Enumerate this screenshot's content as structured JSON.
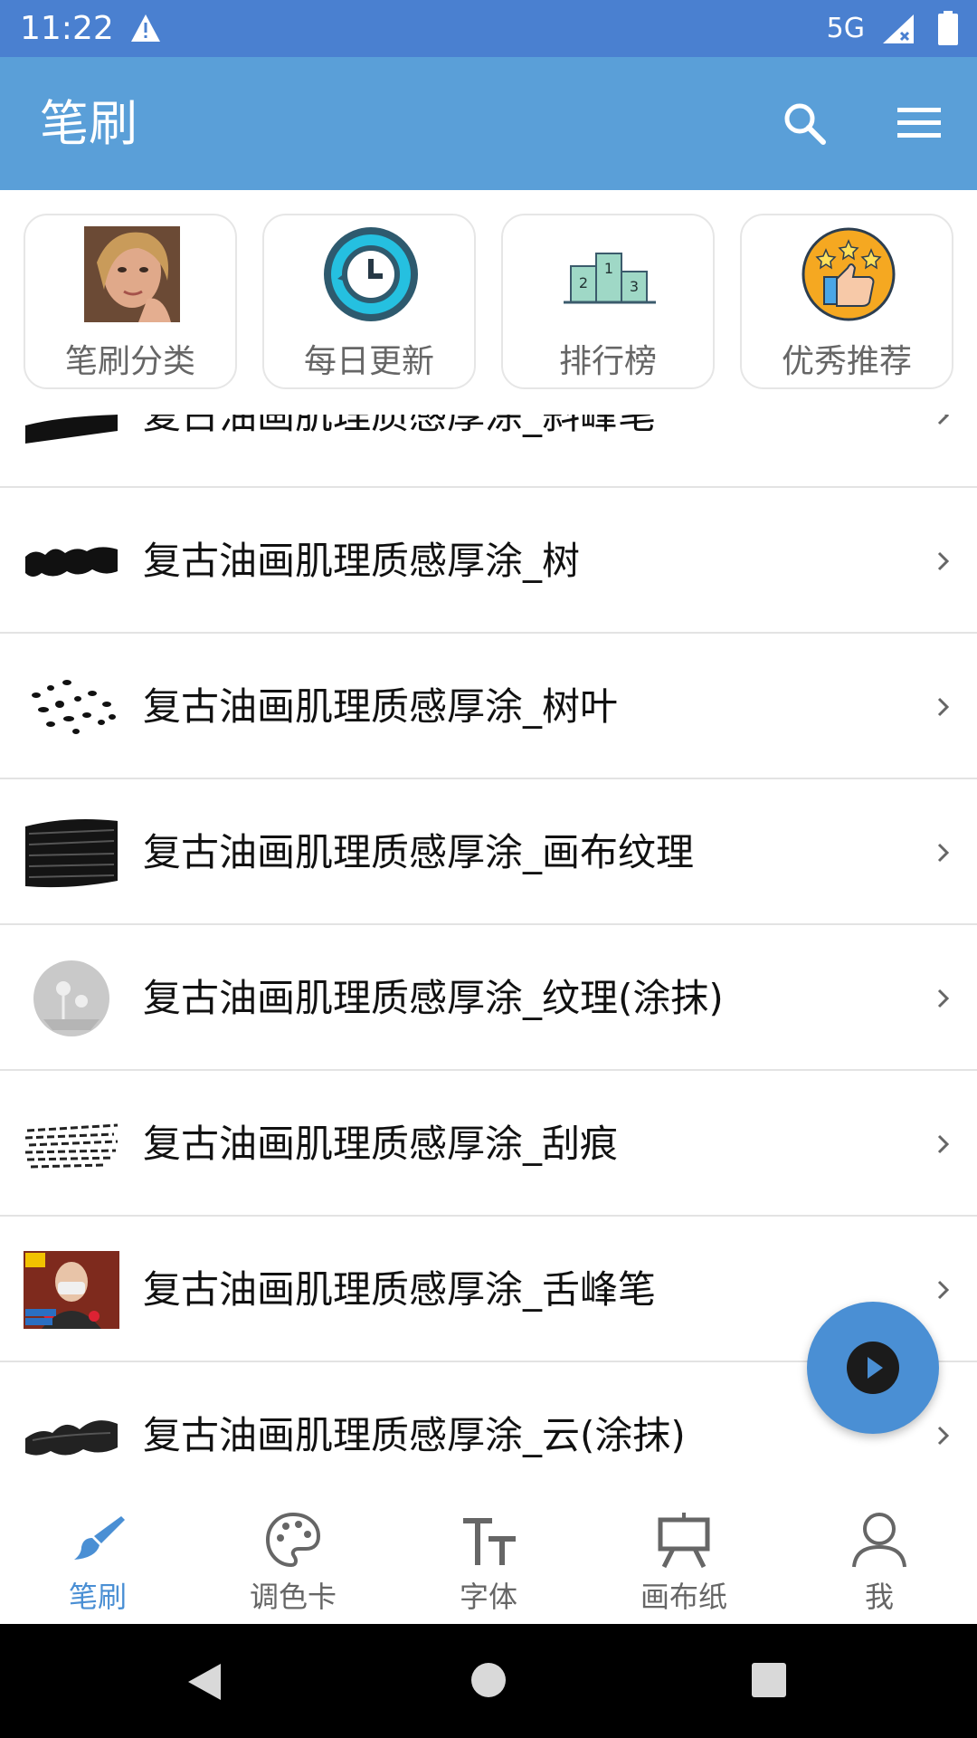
{
  "status_bar": {
    "time": "11:22",
    "network": "5G",
    "icons": [
      "warning-icon",
      "signal-icon",
      "battery-icon"
    ]
  },
  "app_bar": {
    "title": "笔刷",
    "icons": [
      "search-icon",
      "menu-icon"
    ]
  },
  "quick_actions": [
    {
      "label": "笔刷分类",
      "icon": "portrait-thumbnail"
    },
    {
      "label": "每日更新",
      "icon": "clock-refresh-icon"
    },
    {
      "label": "排行榜",
      "icon": "podium-icon"
    },
    {
      "label": "优秀推荐",
      "icon": "thumbs-up-stars-icon"
    }
  ],
  "brush_list": [
    {
      "name": "复古油画肌理质感厚涂_斜峰笔"
    },
    {
      "name": "复古油画肌理质感厚涂_树"
    },
    {
      "name": "复古油画肌理质感厚涂_树叶"
    },
    {
      "name": "复古油画肌理质感厚涂_画布纹理"
    },
    {
      "name": "复古油画肌理质感厚涂_纹理(涂抹)"
    },
    {
      "name": "复古油画肌理质感厚涂_刮痕"
    },
    {
      "name": "复古油画肌理质感厚涂_舌峰笔"
    },
    {
      "name": "复古油画肌理质感厚涂_云(涂抹)"
    }
  ],
  "fab": {
    "icon": "play-icon"
  },
  "bottom_nav": [
    {
      "label": "笔刷",
      "icon": "brush-icon",
      "active": true
    },
    {
      "label": "调色卡",
      "icon": "palette-icon",
      "active": false
    },
    {
      "label": "字体",
      "icon": "font-icon",
      "active": false
    },
    {
      "label": "画布纸",
      "icon": "easel-icon",
      "active": false
    },
    {
      "label": "我",
      "icon": "person-icon",
      "active": false
    }
  ],
  "system_nav": {
    "icons": [
      "back-icon",
      "home-icon",
      "recents-icon"
    ]
  },
  "colors": {
    "status_bar": "#4a80d0",
    "app_bar": "#5a9fd8",
    "accent": "#4a8fd4",
    "text_secondary": "#666666"
  }
}
